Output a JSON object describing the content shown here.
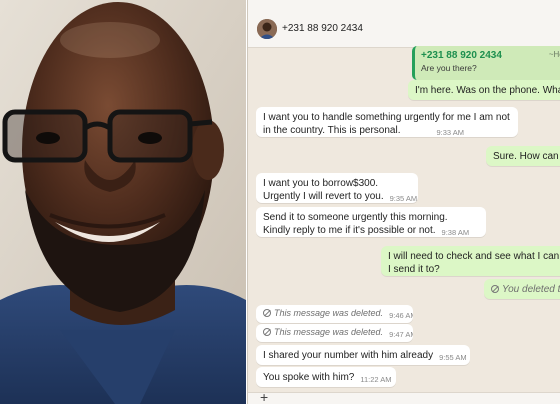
{
  "chat": {
    "contact_number": "+231 88 920 2434",
    "quoted": {
      "name": "+231 88 920 2434",
      "alias": "~Hon. S",
      "text": "Are you there?"
    },
    "messages": [
      {
        "dir": "out",
        "text": "I'm here. Was on the phone. What",
        "time": ""
      },
      {
        "dir": "in",
        "text_lines": [
          "I want you to handle something urgently for me I am not",
          "in the country. This is personal."
        ],
        "time": "9:33 AM"
      },
      {
        "dir": "out",
        "text": "Sure. How can I",
        "time": ""
      },
      {
        "dir": "in",
        "text_lines": [
          "I want you to borrow$300.",
          "Urgently I will revert to you."
        ],
        "time": "9:35 AM"
      },
      {
        "dir": "in",
        "text_lines": [
          "Send it to someone urgently this morning.",
          "Kindly reply to me if it's possible or not."
        ],
        "time": "9:38 AM"
      },
      {
        "dir": "out",
        "text_lines": [
          "I will need to check and see what I can fi",
          "I send it to?"
        ],
        "time": ""
      },
      {
        "dir": "out",
        "deleted": true,
        "text": "You deleted this",
        "time": ""
      },
      {
        "dir": "in",
        "deleted": true,
        "text": "This message was deleted.",
        "time": "9:46 AM"
      },
      {
        "dir": "in",
        "deleted": true,
        "text": "This message was deleted.",
        "time": "9:47 AM"
      },
      {
        "dir": "in",
        "text": "I shared your number with him already",
        "time": "9:55 AM"
      },
      {
        "dir": "in",
        "text": "You spoke with him?",
        "time": "11:22 AM"
      }
    ],
    "input": {
      "plus": "+"
    }
  }
}
